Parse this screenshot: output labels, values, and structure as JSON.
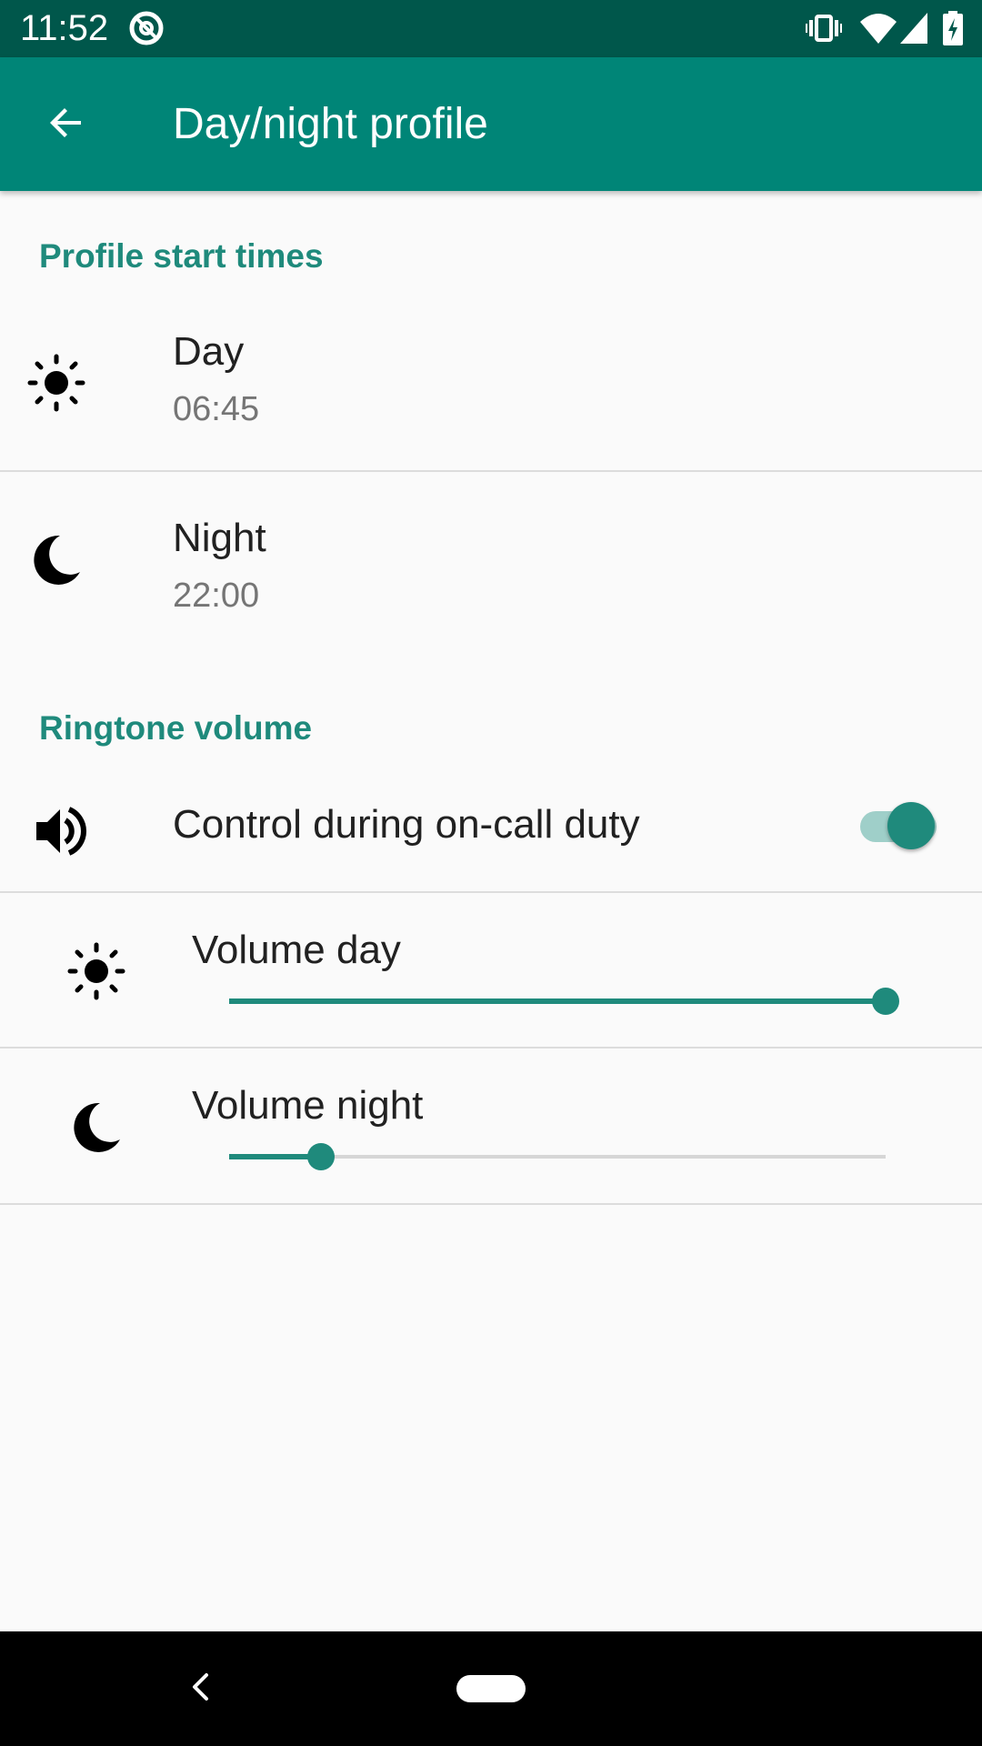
{
  "status_bar": {
    "time": "11:52",
    "icons": [
      "at-sign-icon",
      "vibrate-icon",
      "wifi-icon",
      "cell-signal-icon",
      "battery-charging-icon"
    ],
    "background": "#00574b"
  },
  "app_bar": {
    "title": "Day/night profile",
    "back_icon": "arrow-back-icon",
    "background": "#008577"
  },
  "profile_start_times": {
    "header": "Profile start times",
    "day": {
      "title": "Day",
      "time": "06:45",
      "icon": "sun-icon"
    },
    "night": {
      "title": "Night",
      "time": "22:00",
      "icon": "moon-icon"
    }
  },
  "ringtone_volume": {
    "header": "Ringtone volume",
    "control": {
      "title": "Control during on-call duty",
      "icon": "volume-icon",
      "enabled": true
    },
    "volume_day": {
      "title": "Volume day",
      "icon": "sun-icon",
      "level": 1.0
    },
    "volume_night": {
      "title": "Volume night",
      "icon": "moon-icon",
      "level": 0.14
    }
  },
  "nav_bar": {
    "back_icon": "nav-back-icon",
    "home_icon": "nav-home-pill-icon"
  },
  "colors": {
    "accent": "#1f8a7c",
    "text_primary": "#212121",
    "text_secondary": "#757575",
    "divider": "#dcdcdc"
  }
}
